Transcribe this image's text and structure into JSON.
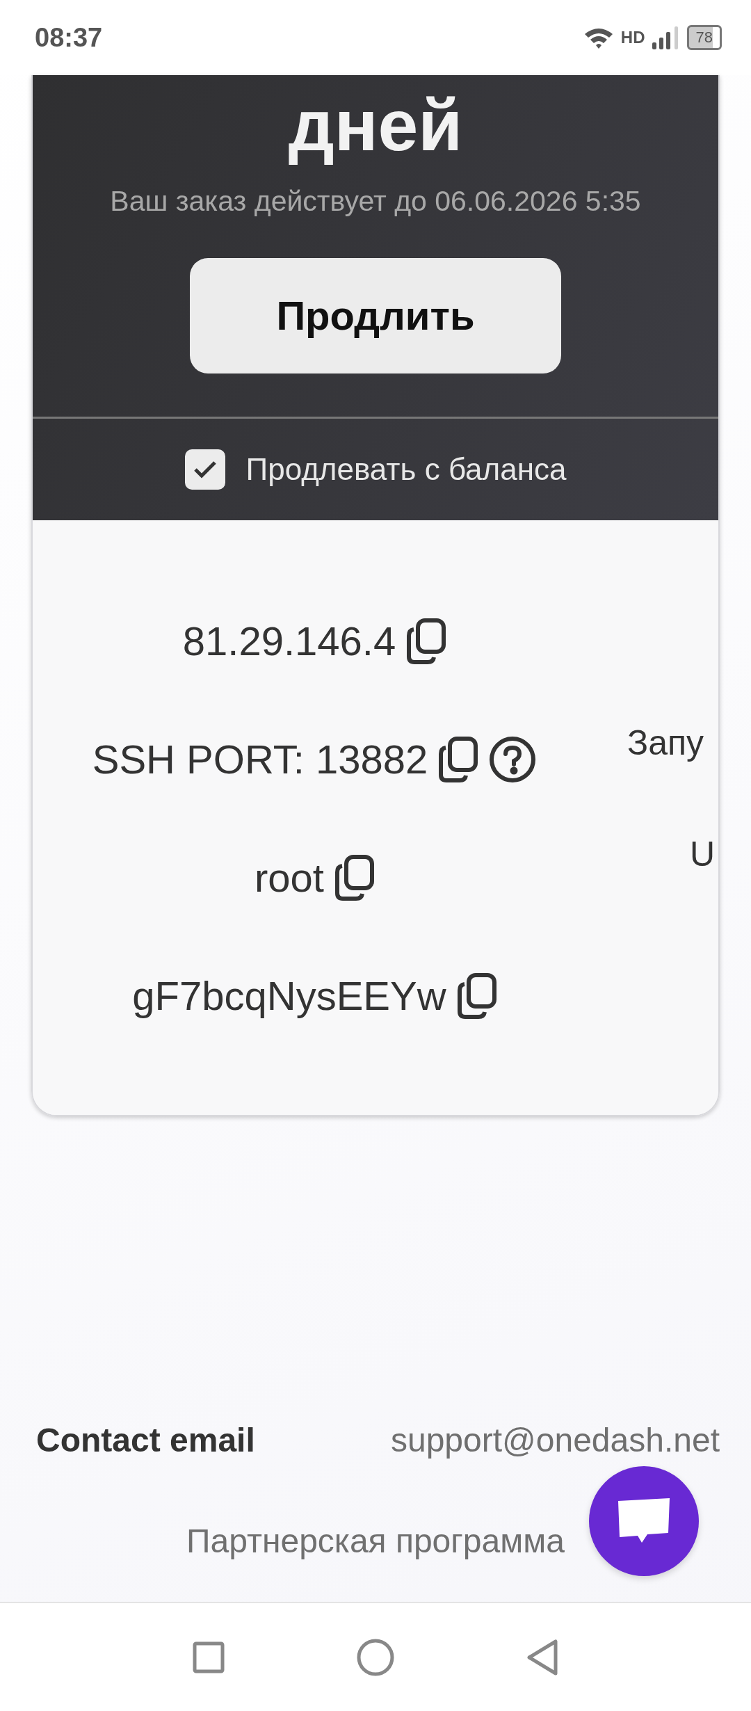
{
  "status_bar": {
    "time": "08:37",
    "network": "HD",
    "battery": "78"
  },
  "plan": {
    "remaining_unit": "дней",
    "expiry_note": "Ваш заказ действует до 06.06.2026 5:35",
    "renew_button": "Продлить",
    "auto_renew": {
      "label": "Продлевать с баланса",
      "checked": true
    }
  },
  "credentials": [
    {
      "value": "81.29.146.4",
      "help": false
    },
    {
      "value": "SSH PORT: 13882",
      "help": true
    },
    {
      "value": "root",
      "help": false
    },
    {
      "value": "gF7bcqNysEEYw",
      "help": false
    }
  ],
  "side_labels": [
    "Запу",
    "U"
  ],
  "footer": {
    "contact_label": "Contact email",
    "contact_email": "support@onedash.net",
    "partner_link": "Партнерская программа"
  }
}
